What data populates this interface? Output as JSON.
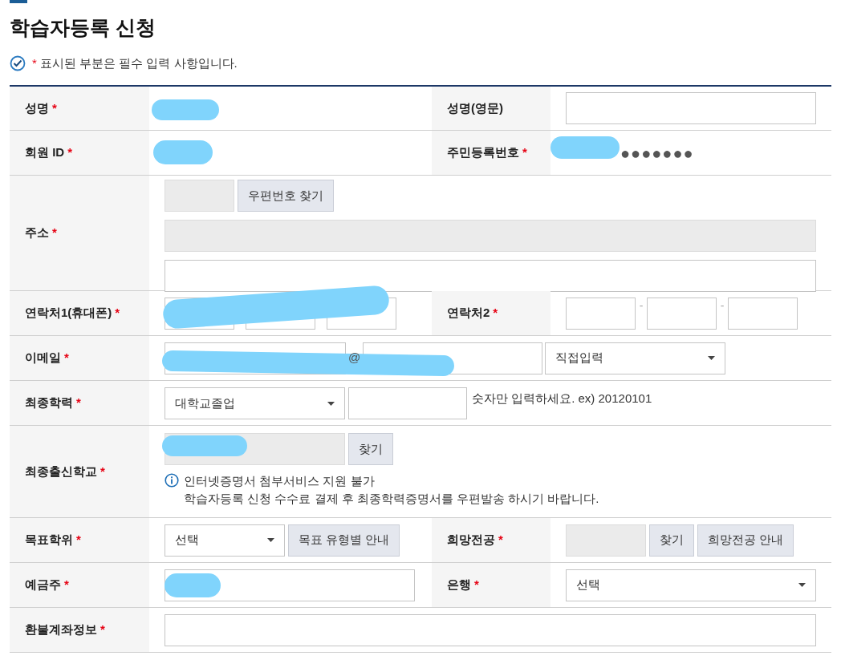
{
  "title": "학습자등록 신청",
  "notice": {
    "mark": "*",
    "text": "표시된 부분은 필수 입력 사항입니다."
  },
  "fields": {
    "name": {
      "label": "성명",
      "mark": "*"
    },
    "name_en": {
      "label": "성명(영문)"
    },
    "member_id": {
      "label": "회원 ID",
      "mark": "*"
    },
    "resident_no": {
      "label": "주민등록번호",
      "mark": "*",
      "value": "●●●●●●●"
    },
    "address": {
      "label": "주소",
      "mark": "*",
      "button": "우편번호 찾기"
    },
    "phone1": {
      "label": "연락처1(휴대폰)",
      "mark": "*"
    },
    "phone2": {
      "label": "연락처2",
      "mark": "*",
      "separators": [
        "-",
        "-"
      ]
    },
    "email": {
      "label": "이메일",
      "mark": "*",
      "at": "@",
      "domain_select": "직접입력"
    },
    "education": {
      "label": "최종학력",
      "mark": "*",
      "select": "대학교졸업",
      "hint": "숫자만 입력하세요. ex) 20120101"
    },
    "school": {
      "label": "최종출신학교",
      "mark": "*",
      "button": "찾기",
      "info": [
        "인터넷증명서 첨부서비스 지원 불가",
        "학습자등록 신청 수수료 결제 후 최종학력증명서를 우편발송 하시기 바랍니다."
      ]
    },
    "degree": {
      "label": "목표학위",
      "mark": "*",
      "select": "선택",
      "button": "목표 유형별 안내"
    },
    "major": {
      "label": "희망전공",
      "mark": "*",
      "buttons": [
        "찾기",
        "희망전공 안내"
      ]
    },
    "holder": {
      "label": "예금주",
      "mark": "*"
    },
    "bank": {
      "label": "은행",
      "mark": "*",
      "select": "선택"
    },
    "refund": {
      "label": "환불계좌정보",
      "mark": "*"
    }
  }
}
